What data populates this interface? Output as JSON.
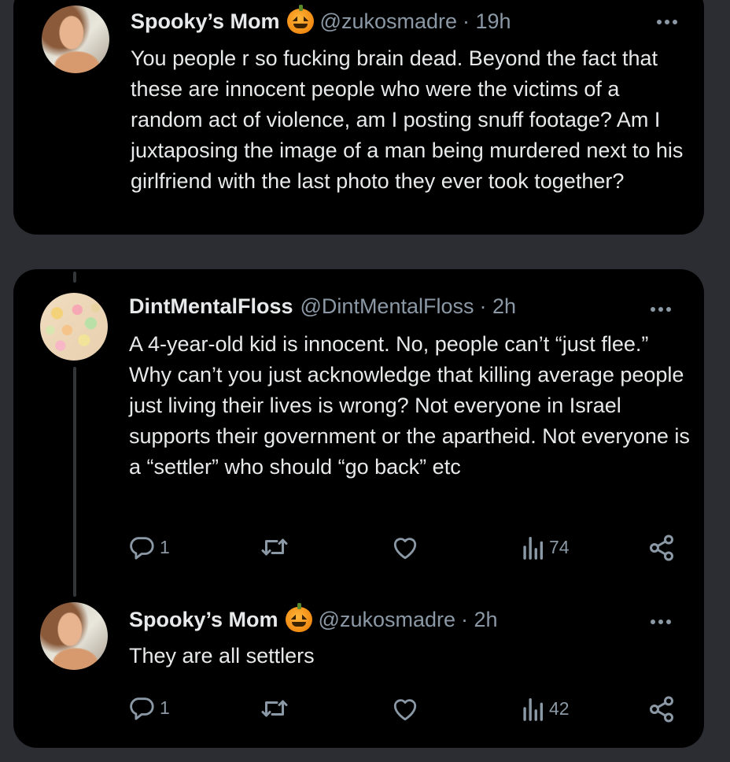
{
  "posts": [
    {
      "name": "Spooky’s Mom",
      "handle": "@zukosmadre",
      "time": "· 19h",
      "text": "You people r so fucking brain dead. Beyond the fact that these are innocent people who were the victims of a random act of violence, am I posting snuff footage? Am I juxtaposing the image of a man being murdered next to his girlfriend with the last photo they ever took together?"
    },
    {
      "name": "DintMentalFloss",
      "handle": "@DintMentalFloss",
      "time": "· 2h",
      "text": "A 4-year-old kid is innocent. No, people can’t “just flee.” Why can’t you just acknowledge that killing average people just living their lives is wrong? Not everyone in Israel supports their government or the apartheid. Not everyone is a “settler” who should “go back” etc",
      "replies": "1",
      "views": "74"
    },
    {
      "name": "Spooky’s Mom",
      "handle": "@zukosmadre",
      "time": "· 2h",
      "text": "They are all settlers",
      "replies": "1",
      "views": "42"
    }
  ],
  "icons": {
    "reply": "reply-icon",
    "retweet": "retweet-icon",
    "like": "heart-icon",
    "views": "views-icon",
    "share": "share-icon",
    "more": "more-icon",
    "emoji": "pumpkin-emoji"
  },
  "colors": {
    "background": "#2b2d33",
    "card": "#000000",
    "text": "#e7e9ea",
    "muted": "#8b98a5"
  }
}
